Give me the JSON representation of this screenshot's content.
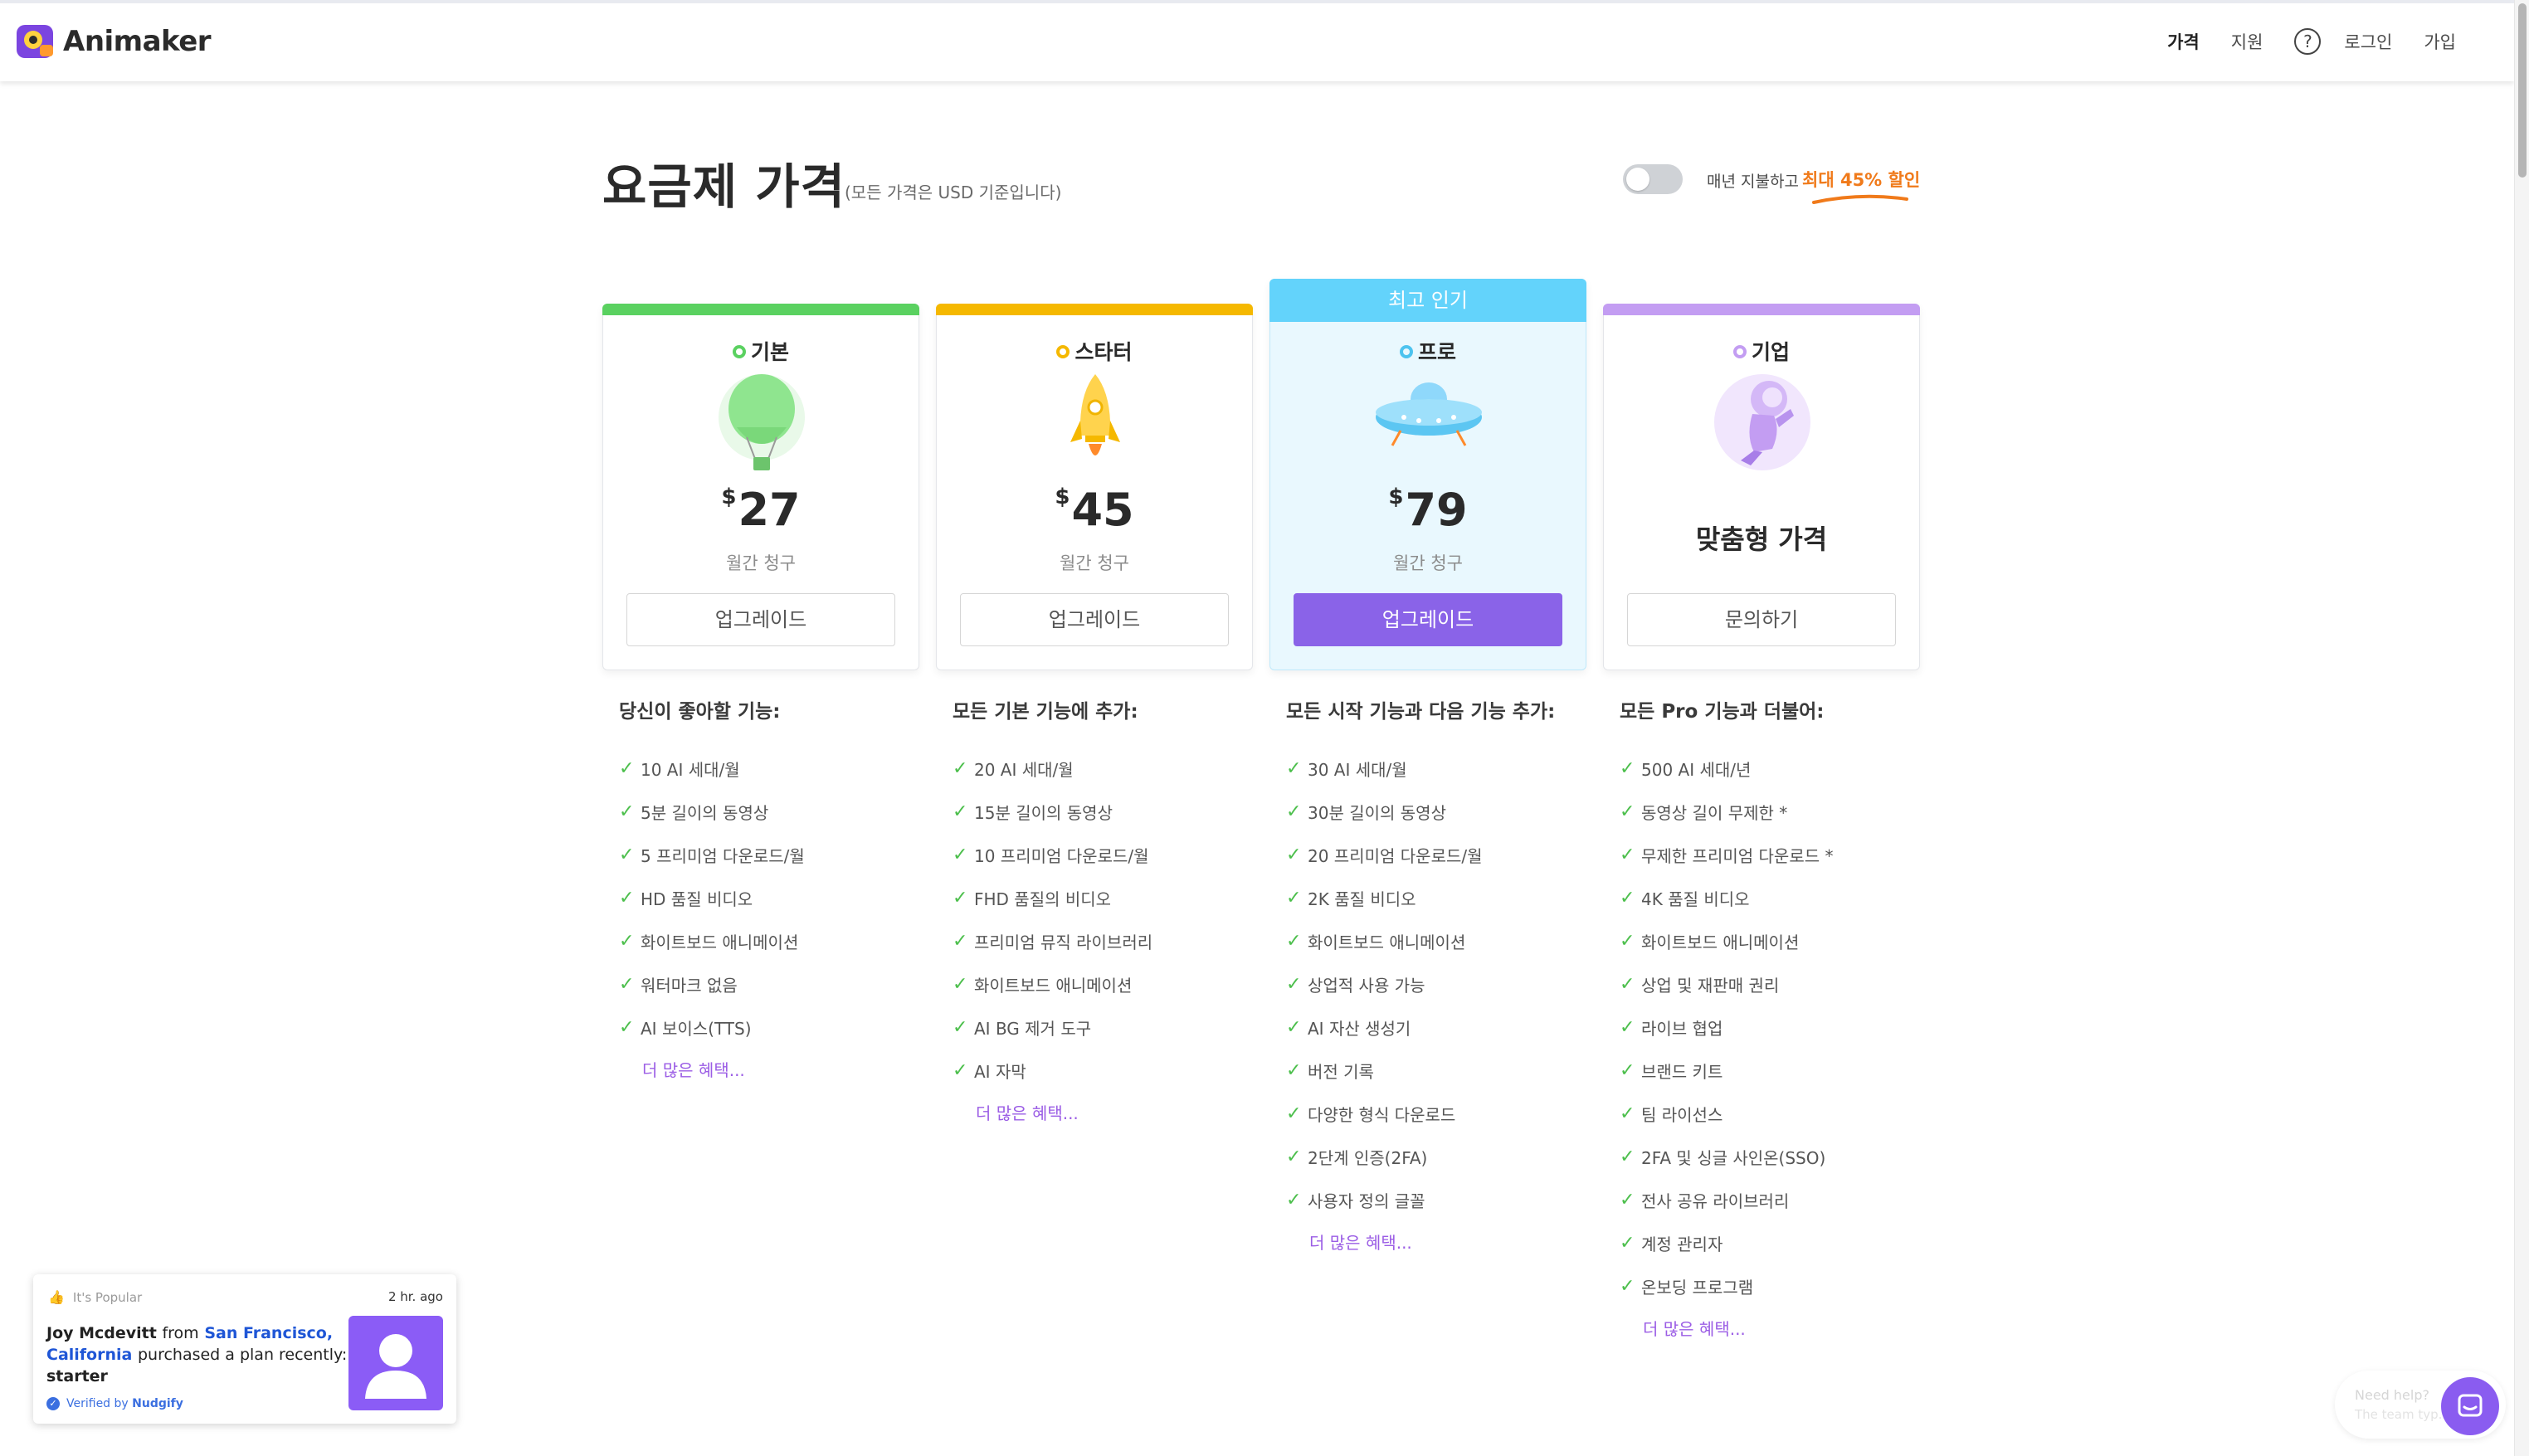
{
  "app": {
    "name": "Animaker",
    "brand_color": "#8a63e8"
  },
  "nav": {
    "pricing": "가격",
    "support": "지원",
    "help_icon": "?",
    "login": "로그인",
    "signup": "가입"
  },
  "title": {
    "heading": "요금제 가격",
    "subtitle": "(모든 가격은 USD 기준입니다)"
  },
  "billing_toggle": {
    "label": "매년 지불하고",
    "discount": "최대 45% 할인",
    "on": false
  },
  "plans": [
    {
      "name": "기본",
      "color": "#5ad160",
      "icon": "hot-air-balloon",
      "currency": "$",
      "price": "27",
      "billing": "월간 청구",
      "cta": "업그레이드",
      "features_heading": "당신이 좋아할 기능:",
      "features": [
        "10 AI 세대/월",
        "5분 길이의 동영상",
        "5 프리미엄 다운로드/월",
        "HD 품질 비디오",
        "화이트보드 애니메이션",
        "워터마크 없음",
        "AI 보이스(TTS)"
      ],
      "more": "더 많은 혜택..."
    },
    {
      "name": "스타터",
      "color": "#f5b800",
      "icon": "rocket",
      "currency": "$",
      "price": "45",
      "billing": "월간 청구",
      "cta": "업그레이드",
      "features_heading": "모든 기본 기능에 추가:",
      "features": [
        "20 AI 세대/월",
        "15분 길이의 동영상",
        "10 프리미엄 다운로드/월",
        "FHD 품질의 비디오",
        "프리미엄 뮤직 라이브러리",
        "화이트보드 애니메이션",
        "AI BG 제거 도구",
        "AI 자막"
      ],
      "more": "더 많은 혜택..."
    },
    {
      "name": "프로",
      "color": "#4cc3ef",
      "icon": "ufo",
      "badge": "최고 인기",
      "currency": "$",
      "price": "79",
      "billing": "월간 청구",
      "cta": "업그레이드",
      "features_heading": "모든 시작 기능과 다음 기능 추가:",
      "features": [
        "30 AI 세대/월",
        "30분 길이의 동영상",
        "20 프리미엄 다운로드/월",
        "2K 품질 비디오",
        "화이트보드 애니메이션",
        "상업적 사용 가능",
        "AI 자산 생성기",
        "버전 기록",
        "다양한 형식 다운로드",
        "2단계 인증(2FA)",
        "사용자 정의 글꼴"
      ],
      "more": "더 많은 혜택..."
    },
    {
      "name": "기업",
      "color": "#c39df2",
      "icon": "astronaut",
      "custom_price": "맞춤형 가격",
      "cta": "문의하기",
      "features_heading": "모든 Pro 기능과 더불어:",
      "features": [
        "500 AI 세대/년",
        "동영상 길이 무제한 *",
        "무제한 프리미엄 다운로드 *",
        "4K 품질 비디오",
        "화이트보드 애니메이션",
        "상업 및 재판매 권리",
        "라이브 협업",
        "브랜드 키트",
        "팀 라이선스",
        "2FA 및 싱글 사인온(SSO)",
        "전사 공유 라이브러리",
        "계정 관리자",
        "온보딩 프로그램"
      ],
      "more": "더 많은 혜택..."
    }
  ],
  "nudge": {
    "label": "It's Popular",
    "time": "2 hr. ago",
    "name": "Joy Mcdevitt",
    "from": "from",
    "city": "San Francisco, California",
    "action": "purchased a plan recently:",
    "plan": "starter",
    "verified": "Verified by",
    "verified_brand": "Nudgify"
  },
  "help_widget": {
    "line1": "Need help?",
    "line2": "The team typ..."
  }
}
